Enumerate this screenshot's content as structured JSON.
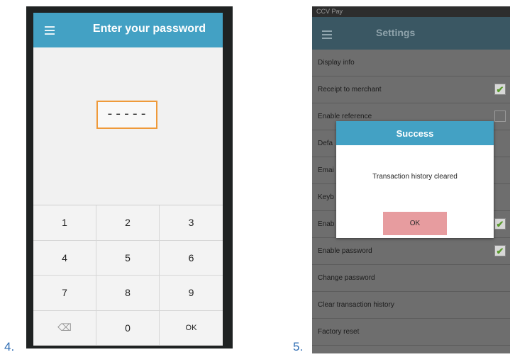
{
  "labels": {
    "left": "4.",
    "right": "5."
  },
  "password_screen": {
    "title": "Enter your password",
    "password_mask": "-----",
    "keys": [
      "1",
      "2",
      "3",
      "4",
      "5",
      "6",
      "7",
      "8",
      "9",
      "⌫",
      "0",
      "OK"
    ]
  },
  "settings_screen": {
    "status_bar": "CCV Pay",
    "title": "Settings",
    "items": [
      {
        "label": "Display info"
      },
      {
        "label": "Receipt to merchant",
        "checked": true
      },
      {
        "label": "Enable reference",
        "checked": false
      },
      {
        "label": "Defa"
      },
      {
        "label": "Emai"
      },
      {
        "label": "Keyb"
      },
      {
        "label": "Enab",
        "checked": true
      },
      {
        "label": "Enable password",
        "checked": true
      },
      {
        "label": "Change password"
      },
      {
        "label": "Clear transaction history"
      },
      {
        "label": "Factory reset"
      }
    ],
    "dialog": {
      "title": "Success",
      "message": "Transaction history cleared",
      "ok_label": "OK"
    }
  },
  "colors": {
    "accent": "#43a1c4",
    "input_border": "#ef9a3a",
    "ok_button": "#e79c9f"
  }
}
